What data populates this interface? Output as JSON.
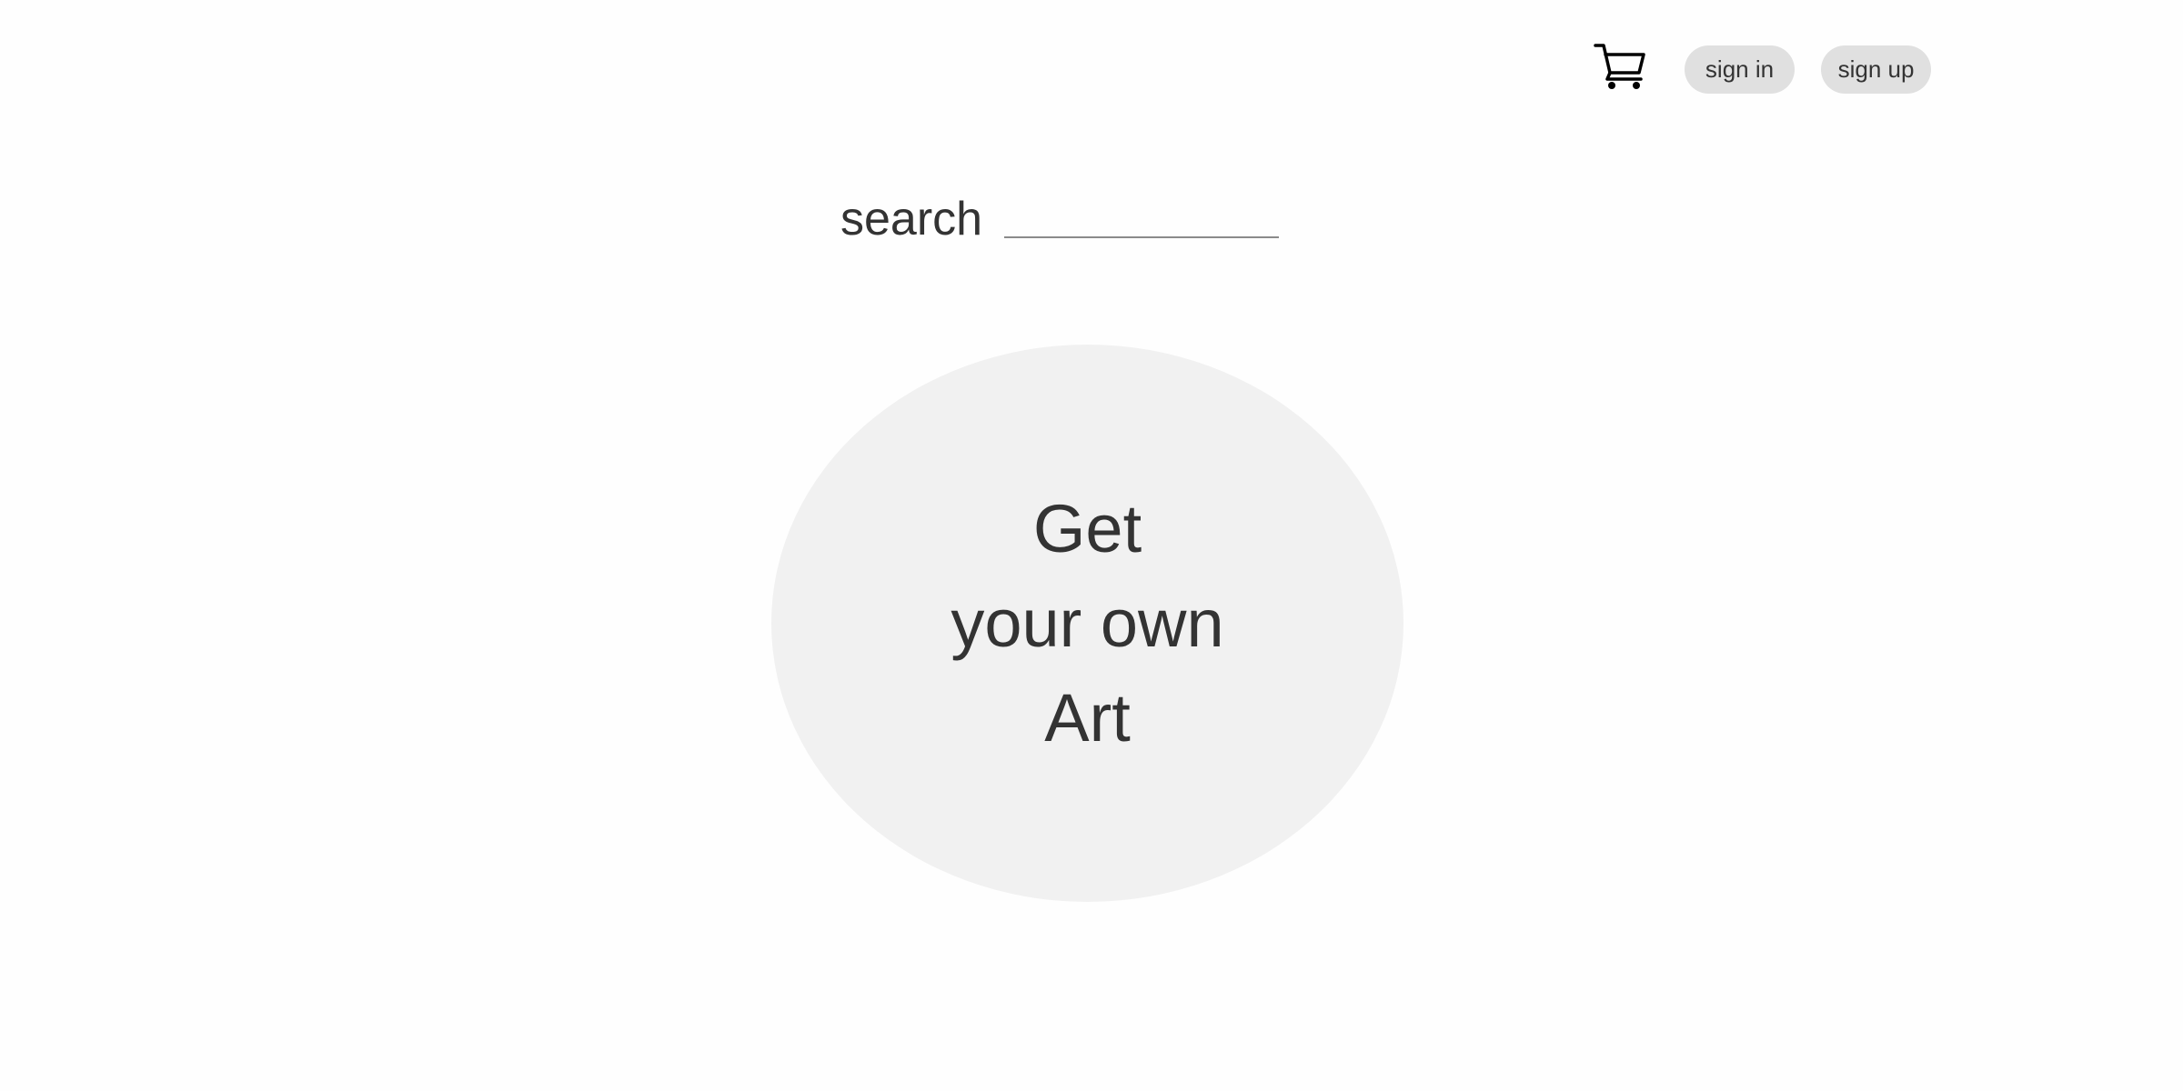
{
  "header": {
    "cart_icon": "shopping-cart-icon",
    "sign_in_label": "sign in",
    "sign_up_label": "sign up"
  },
  "search": {
    "label": "search",
    "value": "",
    "placeholder": ""
  },
  "hero": {
    "lines": [
      "Get",
      "your own",
      "Art"
    ]
  },
  "colors": {
    "background": "#fefefe",
    "text": "#333333",
    "pill_background": "#e0e0e0",
    "hero_background": "#f1f1f1",
    "input_underline": "#8a8a8a"
  }
}
